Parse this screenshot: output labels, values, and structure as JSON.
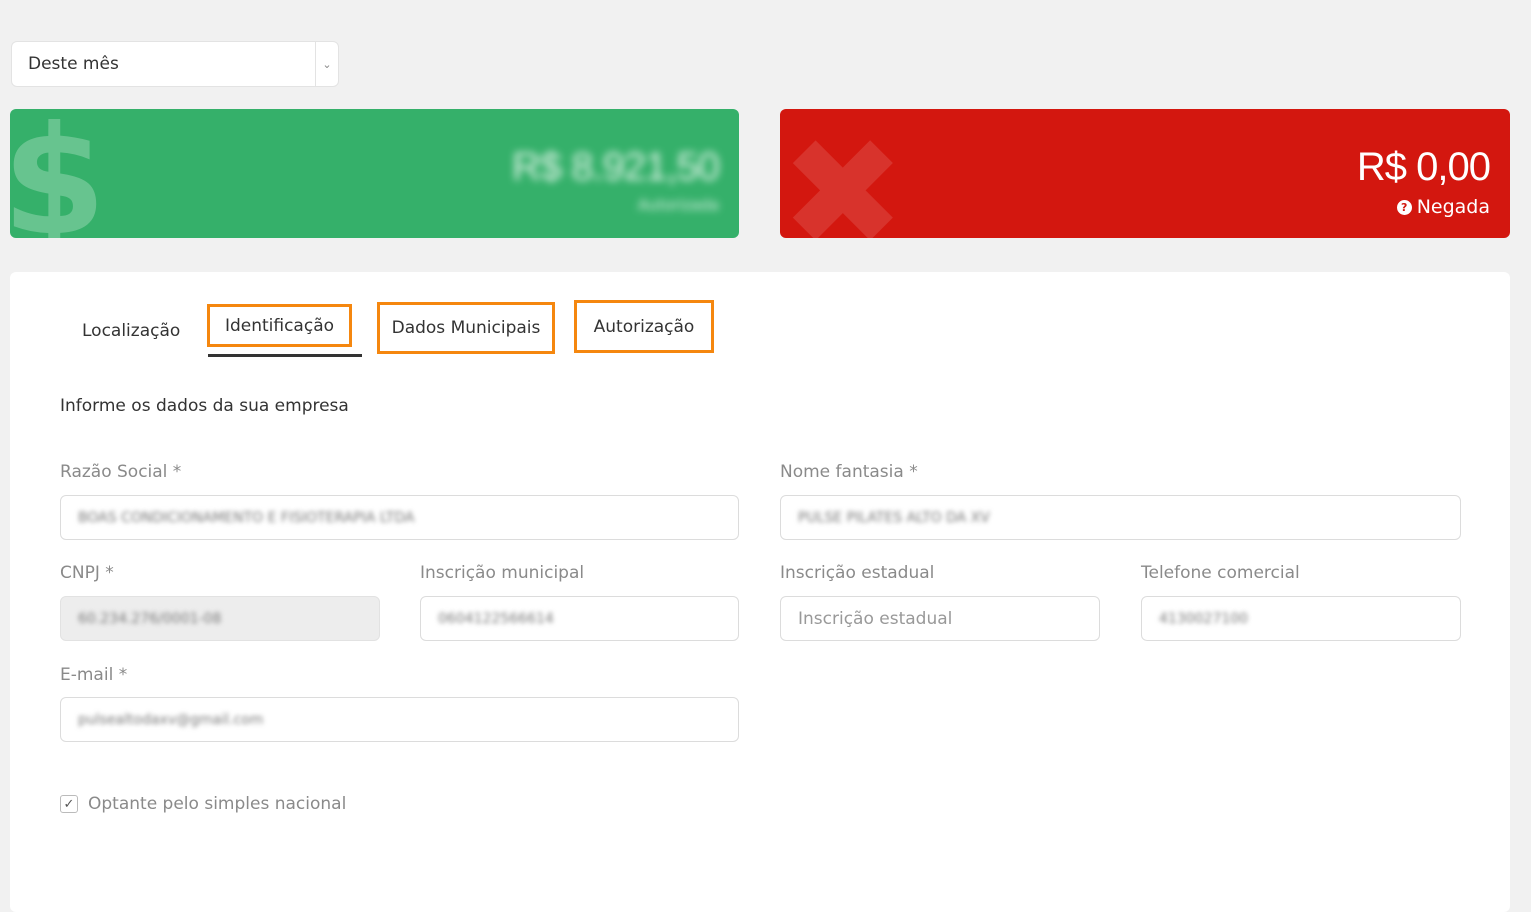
{
  "period_select": {
    "value": "Deste mês",
    "arrow_icon": "chevron-down-icon"
  },
  "cards": {
    "authorized": {
      "amount": "R$ 8.921,50",
      "status": "Autorizada",
      "color": "#35b06a",
      "icon": "dollar-icon"
    },
    "denied": {
      "amount": "R$ 0,00",
      "status": "Negada",
      "color": "#d3170f",
      "icon": "x-icon",
      "help_icon": "?"
    }
  },
  "tabs": [
    {
      "label": "Localização"
    },
    {
      "label": "Identificação",
      "active": true
    },
    {
      "label": "Dados Municipais"
    },
    {
      "label": "Autorização"
    }
  ],
  "highlight_color": "#f5870f",
  "form": {
    "title": "Informe os dados da sua empresa",
    "razao_social": {
      "label": "Razão Social *",
      "value": "BOAS CONDICIONAMENTO E FISIOTERAPIA LTDA"
    },
    "nome_fantasia": {
      "label": "Nome fantasia *",
      "value": "PULSE PILATES ALTO DA XV"
    },
    "cnpj": {
      "label": "CNPJ *",
      "value": "60.234.276/0001-08"
    },
    "inscricao_municipal": {
      "label": "Inscrição municipal",
      "value": "0604122566614"
    },
    "inscricao_estadual": {
      "label": "Inscrição estadual",
      "placeholder": "Inscrição estadual"
    },
    "telefone": {
      "label": "Telefone comercial",
      "value": "4130027100"
    },
    "email": {
      "label": "E-mail *",
      "value": "pulsealtodaxv@gmail.com"
    },
    "simples": {
      "label": "Optante pelo simples nacional",
      "checked": true
    }
  }
}
